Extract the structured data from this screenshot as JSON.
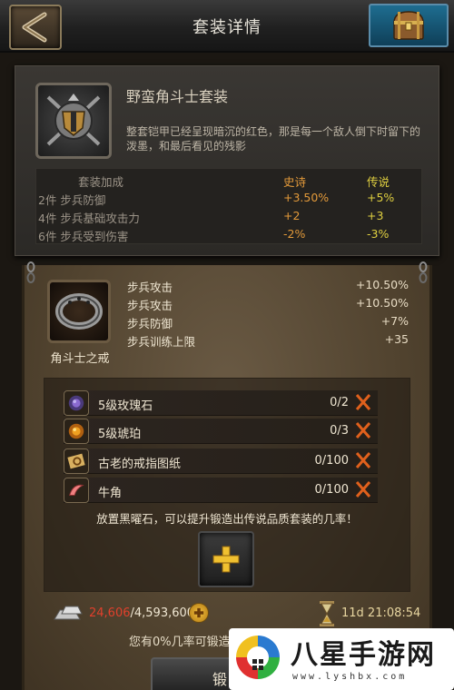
{
  "header": {
    "title": "套装详情"
  },
  "set": {
    "name": "野蛮角斗士套装",
    "description": "整套铠甲已经呈现暗沉的红色，那是每一个敌人倒下时留下的泼墨，和最后看见的残影",
    "bonus_header": {
      "label": "套装加成",
      "epic": "史诗",
      "legendary": "传说"
    },
    "bonuses": [
      {
        "label": "2件 步兵防御",
        "epic": "+3.50%",
        "legendary": "+5%"
      },
      {
        "label": "4件 步兵基础攻击力",
        "epic": "+2",
        "legendary": "+3"
      },
      {
        "label": "6件 步兵受到伤害",
        "epic": "-2%",
        "legendary": "-3%"
      }
    ]
  },
  "item": {
    "name": "角斗士之戒",
    "stats": [
      {
        "label": "步兵攻击",
        "value": "+10.50%"
      },
      {
        "label": "步兵攻击",
        "value": "+10.50%"
      },
      {
        "label": "步兵防御",
        "value": "+7%"
      },
      {
        "label": "步兵训练上限",
        "value": "+35"
      }
    ]
  },
  "materials": [
    {
      "name": "5级玫瑰石",
      "count": "0/2",
      "icon": "rose-stone-icon"
    },
    {
      "name": "5级琥珀",
      "count": "0/3",
      "icon": "amber-icon"
    },
    {
      "name": "古老的戒指图纸",
      "count": "0/100",
      "icon": "ring-blueprint-icon"
    },
    {
      "name": "牛角",
      "count": "0/100",
      "icon": "horn-icon"
    }
  ],
  "hint": "放置黑曜石，可以提升锻造出传说品质套装的几率！",
  "resources": {
    "current": "24,606",
    "required": "/4,593,600",
    "timer": "11d 21:08:54"
  },
  "chance_text": "您有0%几率可锻造",
  "forge_label": "锻",
  "watermark": {
    "text": "八星手游网",
    "url": "www.lyshbx.com"
  },
  "colors": {
    "epic": "#e39a3a",
    "legendary": "#e0d040",
    "currency_insufficient": "#e0402c",
    "cancel_x": "#e0601c"
  }
}
